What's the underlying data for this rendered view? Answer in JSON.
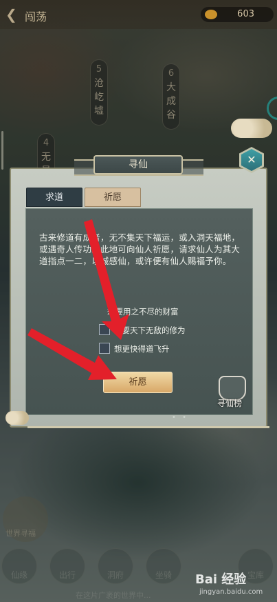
{
  "topbar": {
    "title": "闯荡",
    "gold_value": "603"
  },
  "map_nodes": [
    {
      "num": "5",
      "name_chars": [
        "沧",
        "屹",
        "墟"
      ]
    },
    {
      "num": "6",
      "name_chars": [
        "大",
        "成",
        "谷"
      ]
    },
    {
      "num": "4",
      "name_chars": [
        "无",
        "量"
      ]
    }
  ],
  "dialog": {
    "title": "寻仙",
    "tabs": [
      {
        "label": "求道",
        "active": false
      },
      {
        "label": "祈愿",
        "active": true
      }
    ],
    "description": "古来修道有成者，无不集天下福运，或入洞天福地，或遇奇人传功。此地可向仙人祈愿，请求仙人为其大道指点一二，以诚感仙，或许便有仙人赐福予你。",
    "options": [
      {
        "label": "想要用之不尽的财富",
        "checked": false
      },
      {
        "label": "想要天下无敌的修为",
        "checked": false
      },
      {
        "label": "想更快得道飞升",
        "checked": false
      }
    ],
    "pray_button": "祈愿",
    "xunxian_rank": "寻仙榜"
  },
  "background": {
    "world_quest": "世界寻福",
    "nav_items": [
      "仙缘",
      "出行",
      "洞府",
      "坐骑",
      "宝库"
    ],
    "bottom_note": "在这片广袤的世界中..."
  },
  "watermark": {
    "main": "Bai 经验",
    "sub": "jingyan.baidu.com"
  },
  "colors": {
    "accent_teal": "#2c6f78",
    "button_gold": "#d8a868",
    "arrow_red": "#e3202a"
  }
}
